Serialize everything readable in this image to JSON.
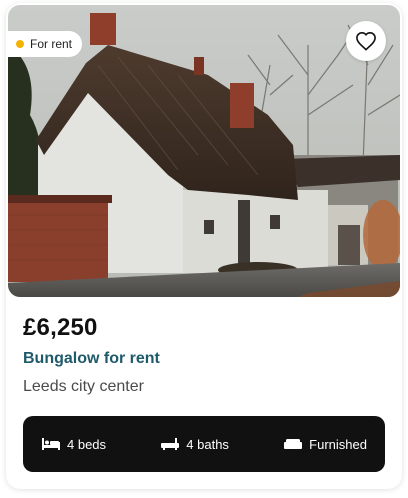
{
  "listing": {
    "status": "For rent",
    "price": "£6,250",
    "title": "Bungalow for rent",
    "location": "Leeds city center",
    "features": {
      "beds": "4 beds",
      "baths": "4 baths",
      "furnishing": "Furnished"
    }
  },
  "icons": {
    "status": "status-dot",
    "favorite": "heart-icon",
    "beds": "bed-icon",
    "baths": "bath-icon",
    "furnishing": "sofa-icon"
  },
  "colors": {
    "title": "#1f5a6b",
    "status_dot": "#f2b300",
    "feature_bar": "#111111"
  }
}
